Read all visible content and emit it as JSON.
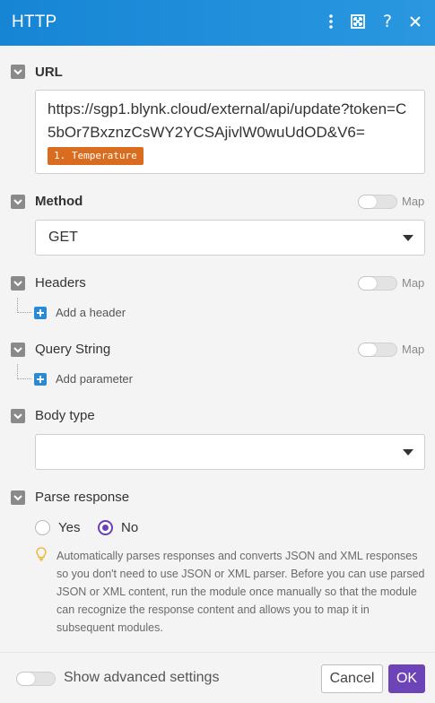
{
  "header": {
    "title": "HTTP",
    "icons": [
      "more-vertical-icon",
      "expand-icon",
      "help-icon",
      "close-icon"
    ]
  },
  "url": {
    "label": "URL",
    "text": "https://sgp1.blynk.cloud/external/api/update?token=C5bOr7BxznzCsWY2YCSAjivlW0wuUdOD&V6=",
    "pill": "1. Temperature"
  },
  "method": {
    "label": "Method",
    "map_label": "Map",
    "value": "GET"
  },
  "headers": {
    "label": "Headers",
    "map_label": "Map",
    "add_label": "Add a header"
  },
  "query": {
    "label": "Query String",
    "map_label": "Map",
    "add_label": "Add parameter"
  },
  "body_type": {
    "label": "Body type",
    "value": ""
  },
  "parse": {
    "label": "Parse response",
    "yes_label": "Yes",
    "no_label": "No",
    "selected": "No",
    "help": "Automatically parses responses and converts JSON and XML responses so you don't need to use JSON or XML parser. Before you can use parsed JSON or XML content, run the module once manually so that the module can recognize the response content and allows you to map it in subsequent modules."
  },
  "footer": {
    "advanced_label": "Show advanced settings",
    "cancel_label": "Cancel",
    "ok_label": "OK"
  },
  "colors": {
    "header": "#1b8ad6",
    "pill": "#d96c1e",
    "accent": "#6d43b8",
    "plus": "#2a8ad4"
  }
}
